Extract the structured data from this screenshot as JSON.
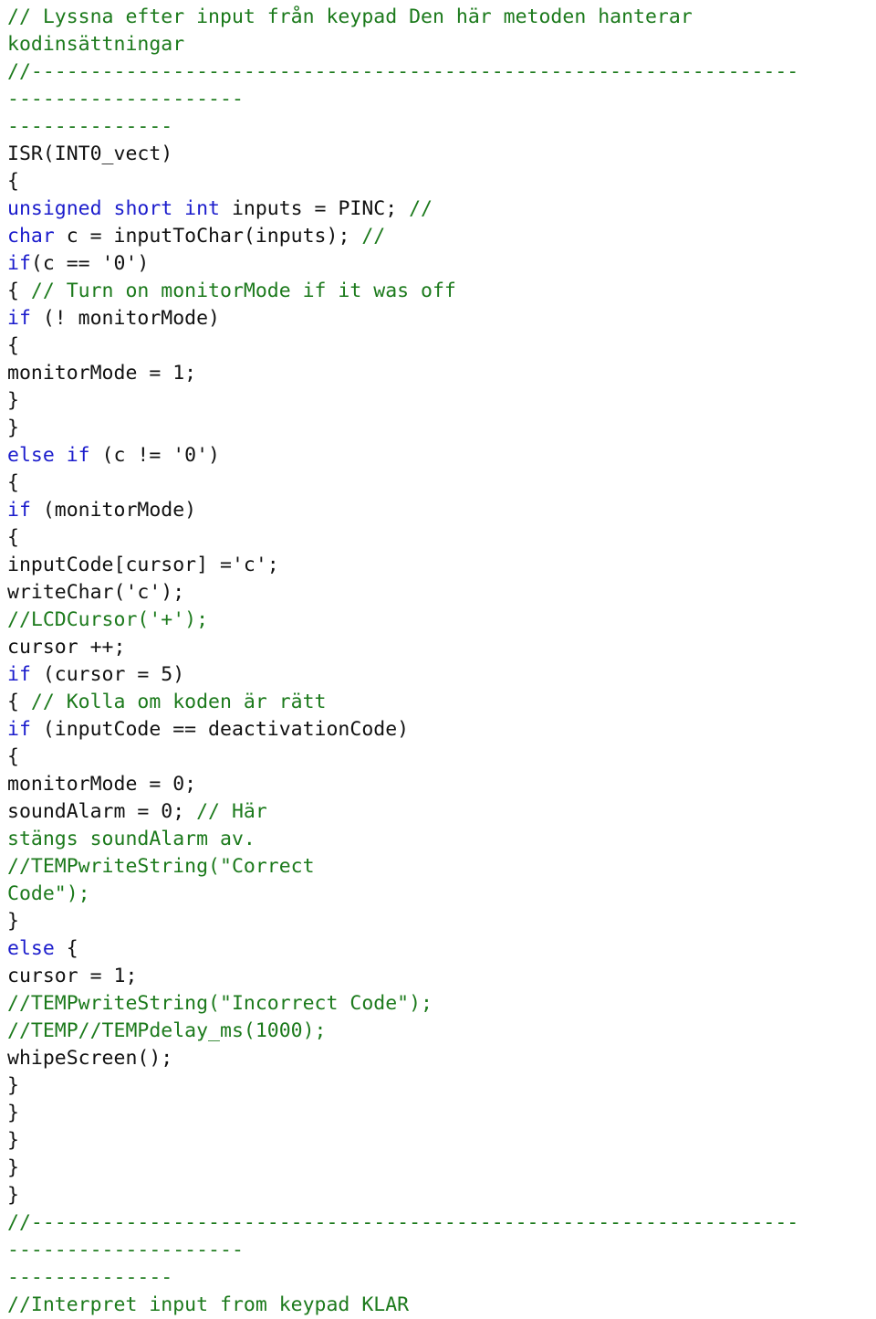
{
  "document": {
    "kind": "source-code-listing",
    "language": "C",
    "colors": {
      "background": "#ffffff",
      "comment": "#1c7a1c",
      "keyword": "#1b1ccc",
      "plain": "#111111"
    },
    "lines": [
      {
        "id": "l1",
        "tokens": [
          {
            "t": "// Lyssna efter input från keypad Den här metoden hanterar",
            "c": "cmt"
          }
        ]
      },
      {
        "id": "l2",
        "tokens": [
          {
            "t": "kodinsättningar",
            "c": "cmt"
          }
        ]
      },
      {
        "id": "l3",
        "tokens": [
          {
            "t": "//-----------------------------------------------------------------",
            "c": "sep"
          }
        ]
      },
      {
        "id": "l4",
        "tokens": [
          {
            "t": "--------------------",
            "c": "sep"
          }
        ]
      },
      {
        "id": "l5",
        "tokens": [
          {
            "t": "--------------",
            "c": "sep"
          }
        ]
      },
      {
        "id": "l6",
        "tokens": [
          {
            "t": "ISR(INT0_vect)",
            "c": "plain"
          }
        ]
      },
      {
        "id": "l7",
        "tokens": [
          {
            "t": "{",
            "c": "plain"
          }
        ]
      },
      {
        "id": "l8",
        "tokens": [
          {
            "t": "unsigned short int",
            "c": "kw"
          },
          {
            "t": " inputs = PINC; ",
            "c": "plain"
          },
          {
            "t": "//",
            "c": "cmt"
          }
        ]
      },
      {
        "id": "l9",
        "tokens": [
          {
            "t": "char",
            "c": "kw"
          },
          {
            "t": " c = inputToChar(inputs); ",
            "c": "plain"
          },
          {
            "t": "//",
            "c": "cmt"
          }
        ]
      },
      {
        "id": "l10",
        "tokens": [
          {
            "t": "if",
            "c": "kw"
          },
          {
            "t": "(c == '0')",
            "c": "plain"
          }
        ]
      },
      {
        "id": "l11",
        "tokens": [
          {
            "t": "{ ",
            "c": "plain"
          },
          {
            "t": "// Turn on monitorMode if it was off",
            "c": "cmt"
          }
        ]
      },
      {
        "id": "l12",
        "tokens": [
          {
            "t": "if",
            "c": "kw"
          },
          {
            "t": " (! monitorMode)",
            "c": "plain"
          }
        ]
      },
      {
        "id": "l13",
        "tokens": [
          {
            "t": "{",
            "c": "plain"
          }
        ]
      },
      {
        "id": "l14",
        "tokens": [
          {
            "t": "monitorMode = 1;",
            "c": "plain"
          }
        ]
      },
      {
        "id": "l15",
        "tokens": [
          {
            "t": "}",
            "c": "plain"
          }
        ]
      },
      {
        "id": "l16",
        "tokens": [
          {
            "t": "}",
            "c": "plain"
          }
        ]
      },
      {
        "id": "l17",
        "tokens": [
          {
            "t": "else if",
            "c": "kw"
          },
          {
            "t": " (c != '0')",
            "c": "plain"
          }
        ]
      },
      {
        "id": "l18",
        "tokens": [
          {
            "t": "{",
            "c": "plain"
          }
        ]
      },
      {
        "id": "l19",
        "tokens": [
          {
            "t": "if",
            "c": "kw"
          },
          {
            "t": " (monitorMode)",
            "c": "plain"
          }
        ]
      },
      {
        "id": "l20",
        "tokens": [
          {
            "t": "{",
            "c": "plain"
          }
        ]
      },
      {
        "id": "l21",
        "tokens": [
          {
            "t": "inputCode[cursor] ='c';",
            "c": "plain"
          }
        ]
      },
      {
        "id": "l22",
        "tokens": [
          {
            "t": "writeChar('c');",
            "c": "plain"
          }
        ]
      },
      {
        "id": "l23",
        "tokens": [
          {
            "t": "//LCDCursor('+');",
            "c": "cmt"
          }
        ]
      },
      {
        "id": "l24",
        "tokens": [
          {
            "t": "cursor ++;",
            "c": "plain"
          }
        ]
      },
      {
        "id": "l25",
        "tokens": [
          {
            "t": "if",
            "c": "kw"
          },
          {
            "t": " (cursor = 5)",
            "c": "plain"
          }
        ]
      },
      {
        "id": "l26",
        "tokens": [
          {
            "t": "{ ",
            "c": "plain"
          },
          {
            "t": "// Kolla om koden är rätt",
            "c": "cmt"
          }
        ]
      },
      {
        "id": "l27",
        "tokens": [
          {
            "t": "if",
            "c": "kw"
          },
          {
            "t": " (inputCode == deactivationCode)",
            "c": "plain"
          }
        ]
      },
      {
        "id": "l28",
        "tokens": [
          {
            "t": "{",
            "c": "plain"
          }
        ]
      },
      {
        "id": "l29",
        "tokens": [
          {
            "t": "monitorMode = 0;",
            "c": "plain"
          }
        ]
      },
      {
        "id": "l30",
        "tokens": [
          {
            "t": "soundAlarm = 0; ",
            "c": "plain"
          },
          {
            "t": "// Här",
            "c": "cmt"
          }
        ]
      },
      {
        "id": "l31",
        "tokens": [
          {
            "t": "stängs soundAlarm av.",
            "c": "cmt"
          }
        ]
      },
      {
        "id": "l32",
        "tokens": [
          {
            "t": "//TEMPwriteString(\"Correct",
            "c": "cmt"
          }
        ]
      },
      {
        "id": "l33",
        "tokens": [
          {
            "t": "Code\");",
            "c": "cmt"
          }
        ]
      },
      {
        "id": "l34",
        "tokens": [
          {
            "t": "}",
            "c": "plain"
          }
        ]
      },
      {
        "id": "l35",
        "tokens": [
          {
            "t": "else",
            "c": "kw"
          },
          {
            "t": " {",
            "c": "plain"
          }
        ]
      },
      {
        "id": "l36",
        "tokens": [
          {
            "t": "cursor = 1;",
            "c": "plain"
          }
        ]
      },
      {
        "id": "l37",
        "tokens": [
          {
            "t": "//TEMPwriteString(\"Incorrect Code\");",
            "c": "cmt"
          }
        ]
      },
      {
        "id": "l38",
        "tokens": [
          {
            "t": "//TEMP//TEMPdelay_ms(1000);",
            "c": "cmt"
          }
        ]
      },
      {
        "id": "l39",
        "tokens": [
          {
            "t": "whipeScreen();",
            "c": "plain"
          }
        ]
      },
      {
        "id": "l40",
        "tokens": [
          {
            "t": "}",
            "c": "plain"
          }
        ]
      },
      {
        "id": "l41",
        "tokens": [
          {
            "t": "}",
            "c": "plain"
          }
        ]
      },
      {
        "id": "l42",
        "tokens": [
          {
            "t": "}",
            "c": "plain"
          }
        ]
      },
      {
        "id": "l43",
        "tokens": [
          {
            "t": "}",
            "c": "plain"
          }
        ]
      },
      {
        "id": "l44",
        "tokens": [
          {
            "t": "}",
            "c": "plain"
          }
        ]
      },
      {
        "id": "l45",
        "tokens": [
          {
            "t": "//-----------------------------------------------------------------",
            "c": "sep"
          }
        ]
      },
      {
        "id": "l46",
        "tokens": [
          {
            "t": "--------------------",
            "c": "sep"
          }
        ]
      },
      {
        "id": "l47",
        "tokens": [
          {
            "t": "--------------",
            "c": "sep"
          }
        ]
      },
      {
        "id": "l48",
        "tokens": [
          {
            "t": "//Interpret input from keypad KLAR",
            "c": "cmt"
          }
        ]
      }
    ]
  }
}
